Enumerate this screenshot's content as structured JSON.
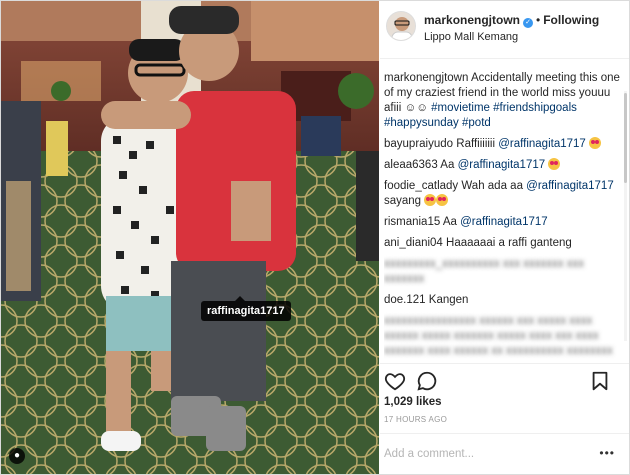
{
  "post": {
    "author": "markonengjtown",
    "follow_status": "Following",
    "location": "Lippo Mall Kemang",
    "tag_label": "raffinagita1717"
  },
  "caption": {
    "user": "markonengjtown",
    "text": "Accidentally meeting this one of my craziest friend in the world miss youuu afiii ☺☺",
    "hashtags": "#movietime #friendshipgoals #happysunday #potd"
  },
  "comments": [
    {
      "user": "bayupraiyudo",
      "text_before": "Raffiiiiiii",
      "mention": "@raffinagita1717",
      "text_after": "",
      "emoji": "heart-eyes"
    },
    {
      "user": "aleaa6363",
      "text_before": "Aa",
      "mention": "@raffinagita1717",
      "text_after": "",
      "emoji": "heart-eyes"
    },
    {
      "user": "foodie_catlady",
      "text_before": "Wah ada aa",
      "mention": "@raffinagita1717",
      "text_after": "sayang",
      "emoji": "heart-eyes x2"
    },
    {
      "user": "rismania15",
      "text_before": "Aa",
      "mention": "@raffinagita1717",
      "text_after": "",
      "emoji": ""
    },
    {
      "user": "ani_diani04",
      "text_before": "Haaaaaai a raffi ganteng",
      "mention": "",
      "text_after": "",
      "emoji": ""
    },
    {
      "user": "doe.121",
      "text_before": "Kangen",
      "mention": "",
      "text_after": "",
      "emoji": ""
    }
  ],
  "footer": {
    "likes": "1,029 likes",
    "time": "17 HOURS AGO",
    "add_comment_placeholder": "Add a comment...",
    "more": "•••"
  },
  "icons": {
    "heart": "heart-outline-icon",
    "comment": "comment-bubble-icon",
    "save": "bookmark-icon",
    "user_tag": "person-tag-icon",
    "verified": "verified-badge-icon"
  },
  "colors": {
    "mention": "#003569",
    "verified": "#3897f0",
    "muted": "#999999"
  }
}
